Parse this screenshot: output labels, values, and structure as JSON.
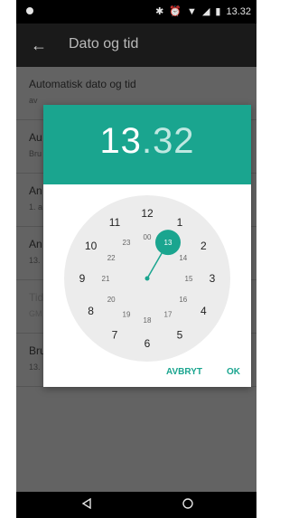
{
  "status_bar": {
    "time": "13.32"
  },
  "toolbar": {
    "title": "Dato og tid"
  },
  "settings": [
    {
      "label": "Automatisk dato og tid",
      "sub": "av",
      "toggle": false,
      "disabled": false
    },
    {
      "label": "Au",
      "sub": "Bru",
      "toggle": true,
      "disabled": false
    },
    {
      "label": "An",
      "sub": "1. a",
      "toggle": false,
      "disabled": false
    },
    {
      "label": "An",
      "sub": "13.",
      "toggle": false,
      "disabled": false
    },
    {
      "label": "Tid",
      "sub": "GM",
      "toggle": false,
      "disabled": true
    },
    {
      "label": "Bru",
      "sub": "13.",
      "toggle": true,
      "disabled": false
    }
  ],
  "dialog": {
    "hour": "13",
    "separator": ".",
    "minute": "32",
    "cancel_label": "AVBRYT",
    "ok_label": "OK",
    "outer_hours": [
      "12",
      "1",
      "2",
      "3",
      "4",
      "5",
      "6",
      "7",
      "8",
      "9",
      "10",
      "11"
    ],
    "inner_hours": [
      "00",
      "13",
      "14",
      "15",
      "16",
      "17",
      "18",
      "19",
      "20",
      "21",
      "22",
      "23"
    ],
    "selected_hour": "13",
    "accent_color": "#1aa58f"
  }
}
